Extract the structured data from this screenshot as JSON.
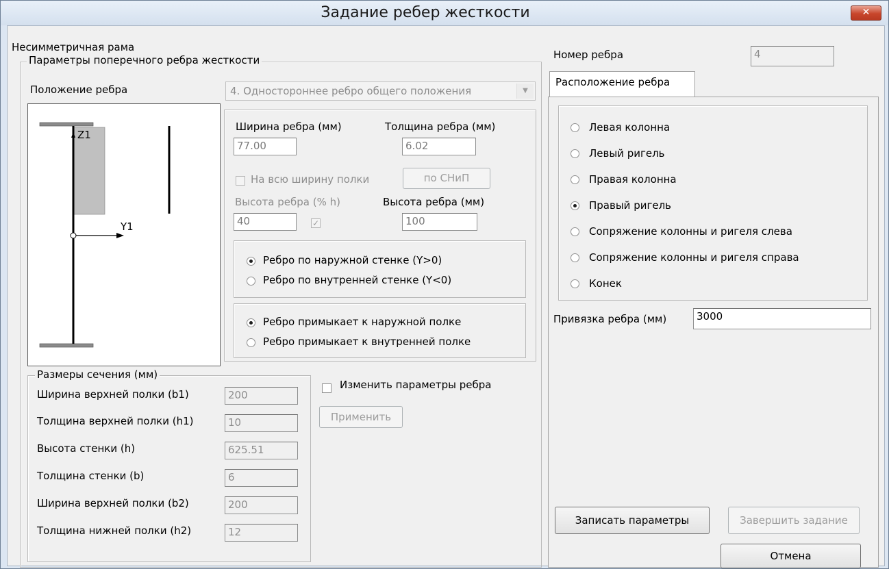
{
  "window": {
    "title": "Задание ребер жесткости",
    "close_glyph": "✕"
  },
  "frame_type": "Несимметричная рама",
  "rib_params": {
    "group_title": "Параметры поперечного ребра жесткости",
    "position_label": "Положение ребра",
    "position_value": "4. Одностороннее ребро общего положения",
    "width_label": "Ширина ребра (мм)",
    "width_value": "77.00",
    "thickness_label": "Толщина ребра (мм)",
    "thickness_value": "6.02",
    "full_width_label": "На всю ширину полки",
    "snip_button": "по СНиП",
    "height_pct_label": "Высота ребра (% h)",
    "height_pct_value": "40",
    "height_mm_label": "Высота ребра (мм)",
    "height_mm_value": "100",
    "wall_options": [
      "Ребро по наружной стенке (Y>0)",
      "Ребро по внутренней стенке (Y<0)"
    ],
    "wall_selected": 0,
    "flange_options": [
      "Ребро примыкает к наружной полке",
      "Ребро примыкает к внутренней полке"
    ],
    "flange_selected": 0
  },
  "diagram": {
    "z_label": "Z1",
    "y_label": "Y1"
  },
  "section": {
    "group_title": "Размеры сечения (мм)",
    "rows": [
      {
        "label": "Ширина верхней полки (b1)",
        "value": "200"
      },
      {
        "label": "Толщина верхней полки (h1)",
        "value": "10"
      },
      {
        "label": "Высота стенки (h)",
        "value": "625.51"
      },
      {
        "label": "Толщина стенки (b)",
        "value": "6"
      },
      {
        "label": "Ширина верхней полки (b2)",
        "value": "200"
      },
      {
        "label": "Толщина нижней полки (h2)",
        "value": "12"
      }
    ]
  },
  "change_params_label": "Изменить параметры ребра",
  "apply_button": "Применить",
  "rib_number_label": "Номер ребра",
  "rib_number_value": "4",
  "location": {
    "tab_label": "Расположение ребра",
    "options": [
      "Левая колонна",
      "Левый ригель",
      "Правая колонна",
      "Правый ригель",
      "Сопряжение колонны и ригеля слева",
      "Сопряжение колонны и ригеля справа",
      "Конек"
    ],
    "selected": 3,
    "anchor_label": "Привязка ребра (мм)",
    "anchor_value": "3000"
  },
  "buttons": {
    "save": "Записать параметры",
    "finish": "Завершить задание",
    "cancel": "Отмена"
  }
}
